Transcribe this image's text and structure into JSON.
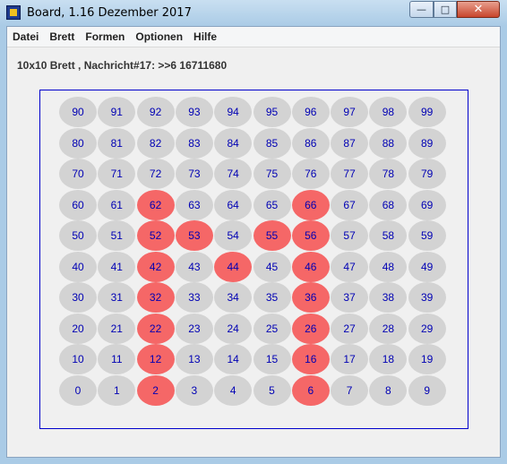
{
  "window": {
    "title": "Board, 1.16 Dezember 2017",
    "minimize": "—",
    "maximize": "□",
    "close": "✕"
  },
  "menu": [
    "Datei",
    "Brett",
    "Formen",
    "Optionen",
    "Hilfe"
  ],
  "status": "10x10 Brett , Nachricht#17: >>6 16711680",
  "board": {
    "rows": 10,
    "cols": 10,
    "cell_color": "#d3d3d3",
    "marked_color": "#f56767",
    "number_color": "#0000b4",
    "frame_color": "#0000cc",
    "marked": [
      2,
      6,
      12,
      16,
      22,
      26,
      32,
      36,
      42,
      44,
      46,
      52,
      53,
      55,
      56,
      62,
      66
    ]
  }
}
